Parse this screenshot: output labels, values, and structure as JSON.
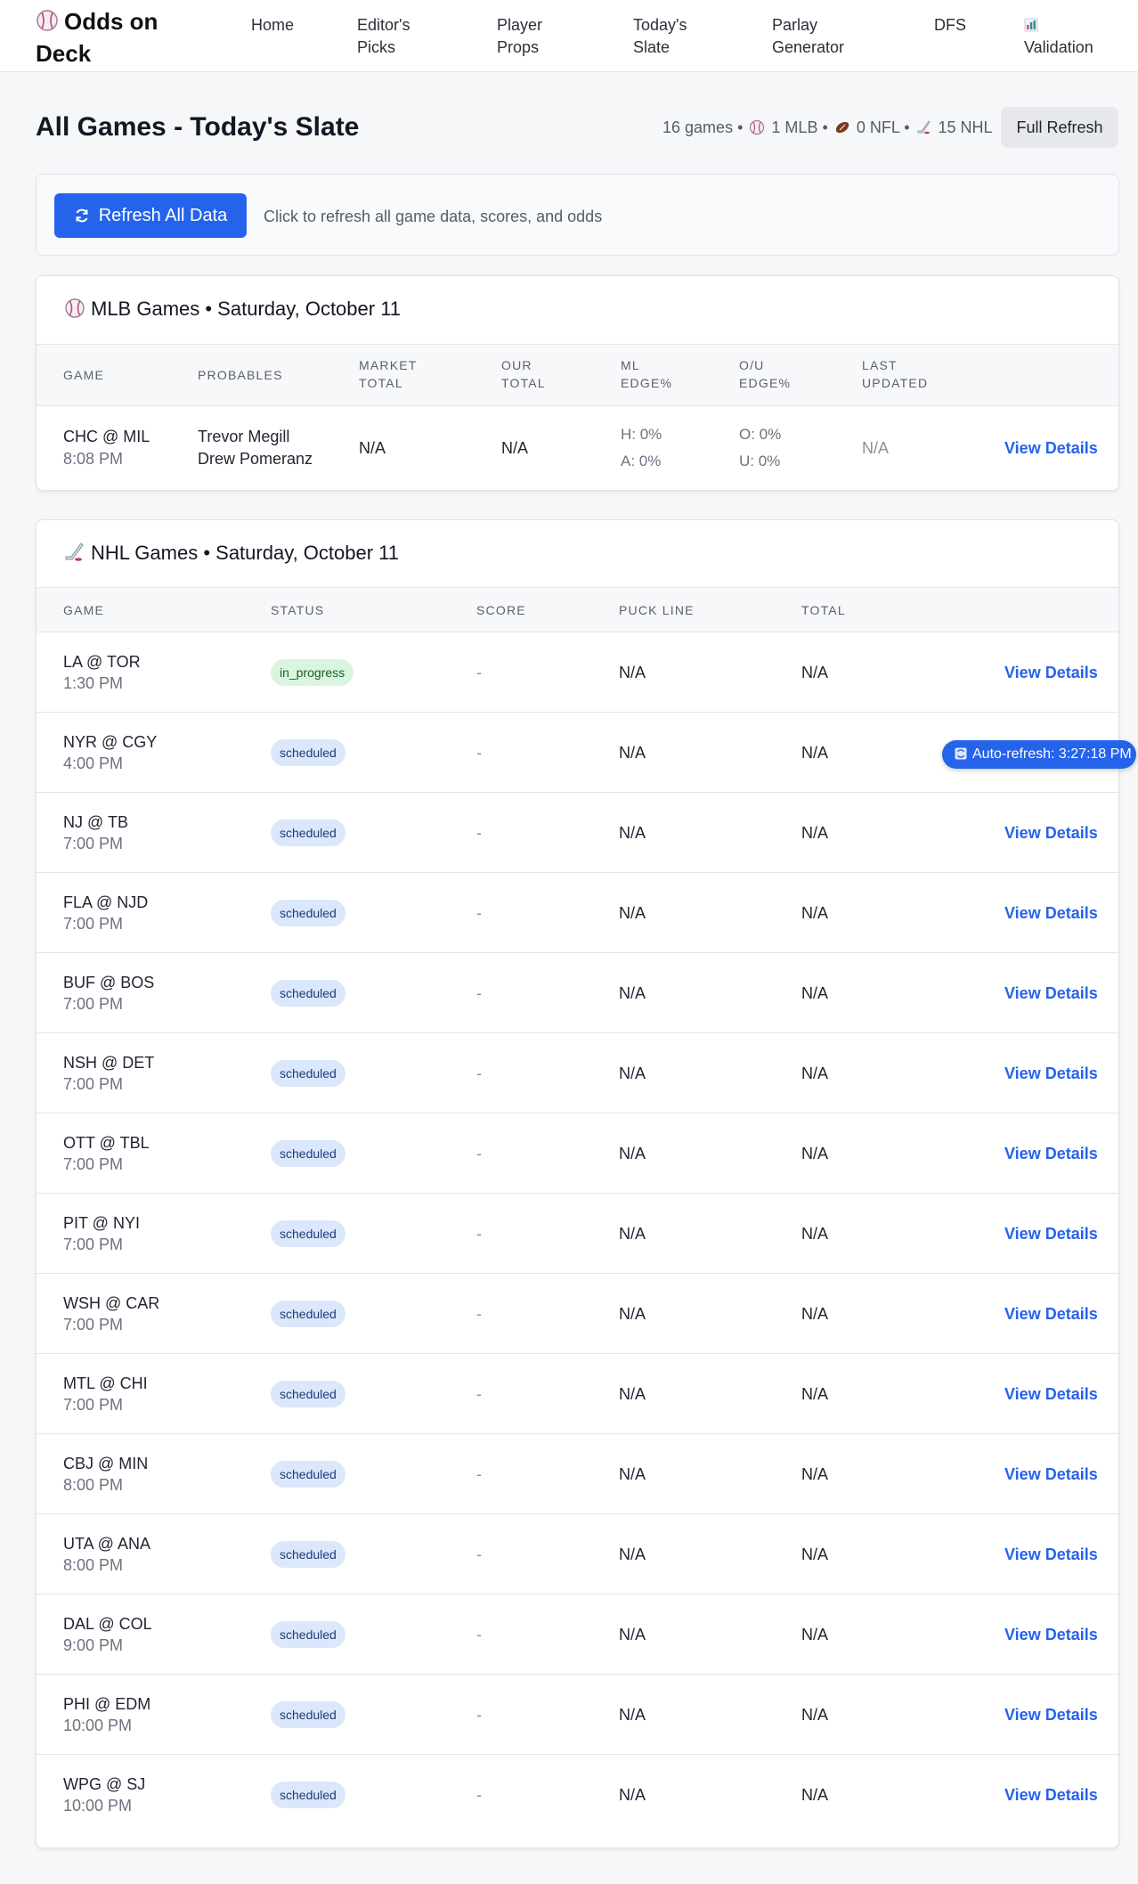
{
  "nav": {
    "brand": "Odds on Deck",
    "links": [
      "Home",
      "Editor's Picks",
      "Player Props",
      "Today's Slate",
      "Parlay Generator",
      "DFS",
      "Validation"
    ]
  },
  "header": {
    "title": "All Games - Today's Slate",
    "summary": {
      "games": "16 games",
      "mlb": "1 MLB",
      "nfl": "0 NFL",
      "nhl": "15 NHL",
      "separator": "•"
    },
    "full_refresh": "Full Refresh"
  },
  "refresh_panel": {
    "button": "Refresh All Data",
    "hint": "Click to refresh all game data, scores, and odds"
  },
  "mlb": {
    "title": "MLB Games • Saturday, October 11",
    "columns": [
      "Game",
      "Probables",
      "Market Total",
      "Our Total",
      "ML Edge%",
      "O/U Edge%",
      "Last Updated"
    ],
    "rows": [
      {
        "game": "CHC @ MIL",
        "time": "8:08 PM",
        "probable_away": "Trevor Megill",
        "probable_home": "Drew Pomeranz",
        "market_total": "N/A",
        "our_total": "N/A",
        "ml_home": "H: 0%",
        "ml_away": "A: 0%",
        "ou_over": "O: 0%",
        "ou_under": "U: 0%",
        "last_updated": "N/A",
        "action": "View Details"
      }
    ]
  },
  "nhl": {
    "title": "NHL Games • Saturday, October 11",
    "columns": [
      "Game",
      "Status",
      "Score",
      "Puck Line",
      "Total"
    ],
    "rows": [
      {
        "game": "LA @ TOR",
        "time": "1:30 PM",
        "status": "in_progress",
        "score": "-",
        "puck_line": "N/A",
        "total": "N/A",
        "action": "View Details"
      },
      {
        "game": "NYR @ CGY",
        "time": "4:00 PM",
        "status": "scheduled",
        "score": "-",
        "puck_line": "N/A",
        "total": "N/A",
        "action": ""
      },
      {
        "game": "NJ @ TB",
        "time": "7:00 PM",
        "status": "scheduled",
        "score": "-",
        "puck_line": "N/A",
        "total": "N/A",
        "action": "View Details"
      },
      {
        "game": "FLA @ NJD",
        "time": "7:00 PM",
        "status": "scheduled",
        "score": "-",
        "puck_line": "N/A",
        "total": "N/A",
        "action": "View Details"
      },
      {
        "game": "BUF @ BOS",
        "time": "7:00 PM",
        "status": "scheduled",
        "score": "-",
        "puck_line": "N/A",
        "total": "N/A",
        "action": "View Details"
      },
      {
        "game": "NSH @ DET",
        "time": "7:00 PM",
        "status": "scheduled",
        "score": "-",
        "puck_line": "N/A",
        "total": "N/A",
        "action": "View Details"
      },
      {
        "game": "OTT @ TBL",
        "time": "7:00 PM",
        "status": "scheduled",
        "score": "-",
        "puck_line": "N/A",
        "total": "N/A",
        "action": "View Details"
      },
      {
        "game": "PIT @ NYI",
        "time": "7:00 PM",
        "status": "scheduled",
        "score": "-",
        "puck_line": "N/A",
        "total": "N/A",
        "action": "View Details"
      },
      {
        "game": "WSH @ CAR",
        "time": "7:00 PM",
        "status": "scheduled",
        "score": "-",
        "puck_line": "N/A",
        "total": "N/A",
        "action": "View Details"
      },
      {
        "game": "MTL @ CHI",
        "time": "7:00 PM",
        "status": "scheduled",
        "score": "-",
        "puck_line": "N/A",
        "total": "N/A",
        "action": "View Details"
      },
      {
        "game": "CBJ @ MIN",
        "time": "8:00 PM",
        "status": "scheduled",
        "score": "-",
        "puck_line": "N/A",
        "total": "N/A",
        "action": "View Details"
      },
      {
        "game": "UTA @ ANA",
        "time": "8:00 PM",
        "status": "scheduled",
        "score": "-",
        "puck_line": "N/A",
        "total": "N/A",
        "action": "View Details"
      },
      {
        "game": "DAL @ COL",
        "time": "9:00 PM",
        "status": "scheduled",
        "score": "-",
        "puck_line": "N/A",
        "total": "N/A",
        "action": "View Details"
      },
      {
        "game": "PHI @ EDM",
        "time": "10:00 PM",
        "status": "scheduled",
        "score": "-",
        "puck_line": "N/A",
        "total": "N/A",
        "action": "View Details"
      },
      {
        "game": "WPG @ SJ",
        "time": "10:00 PM",
        "status": "scheduled",
        "score": "-",
        "puck_line": "N/A",
        "total": "N/A",
        "action": "View Details"
      }
    ]
  },
  "toast": {
    "label": "Auto-refresh: 3:27:18 PM"
  },
  "colors": {
    "accent": "#2563eb",
    "scheduled_badge": "#dbe7fb",
    "in_progress_badge": "#d9f5df"
  },
  "icons": [
    "baseball-icon",
    "football-icon",
    "hockey-icon",
    "refresh-icon",
    "chart-icon"
  ]
}
